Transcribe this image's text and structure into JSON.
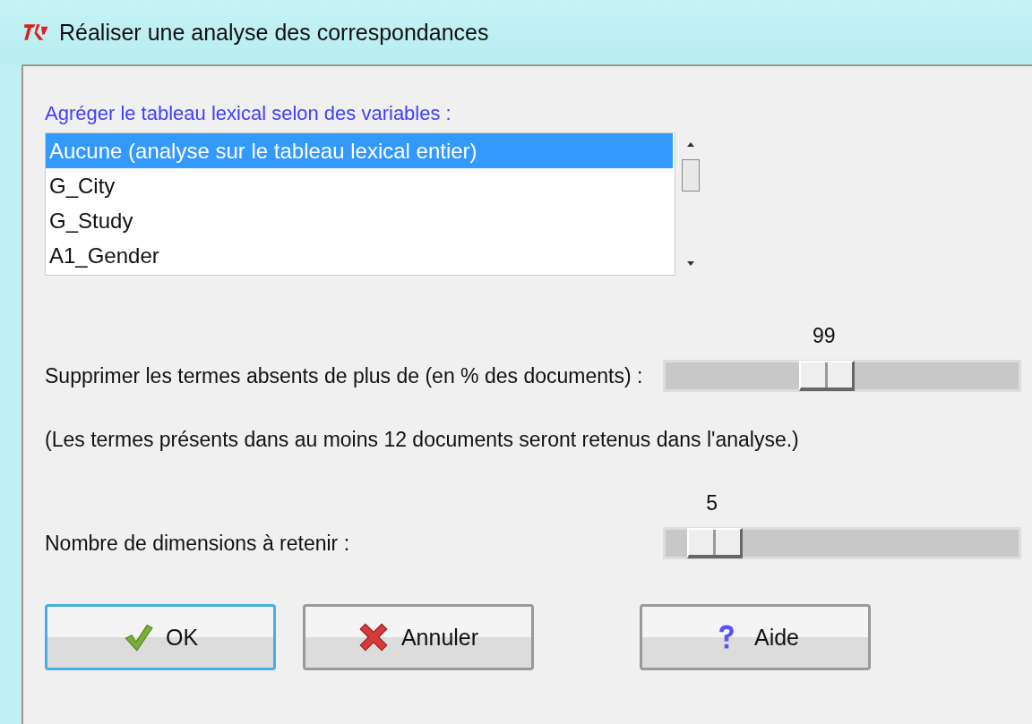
{
  "window": {
    "title": "Réaliser une analyse des correspondances"
  },
  "variables": {
    "label": "Agréger le tableau lexical selon des variables :",
    "items": [
      {
        "text": "Aucune (analyse sur le tableau lexical entier)",
        "selected": true
      },
      {
        "text": "G_City",
        "selected": false
      },
      {
        "text": "G_Study",
        "selected": false
      },
      {
        "text": "A1_Gender",
        "selected": false
      }
    ]
  },
  "sliders": [
    {
      "label": "Supprimer les termes absents de plus de (en % des documents) :",
      "reading": "99",
      "level": 0.44
    },
    {
      "label": "Nombre de dimensions à retenir :",
      "reading": "5",
      "level": 0.07
    }
  ],
  "note": "(Les termes présents dans au moins 12 documents seront retenus dans l'analyse.)",
  "buttons": [
    {
      "kind": "ok",
      "label": "OK",
      "focused": true
    },
    {
      "kind": "cancel",
      "label": "Annuler",
      "focused": false
    },
    {
      "kind": "help",
      "label": "Aide",
      "focused": false
    }
  ]
}
